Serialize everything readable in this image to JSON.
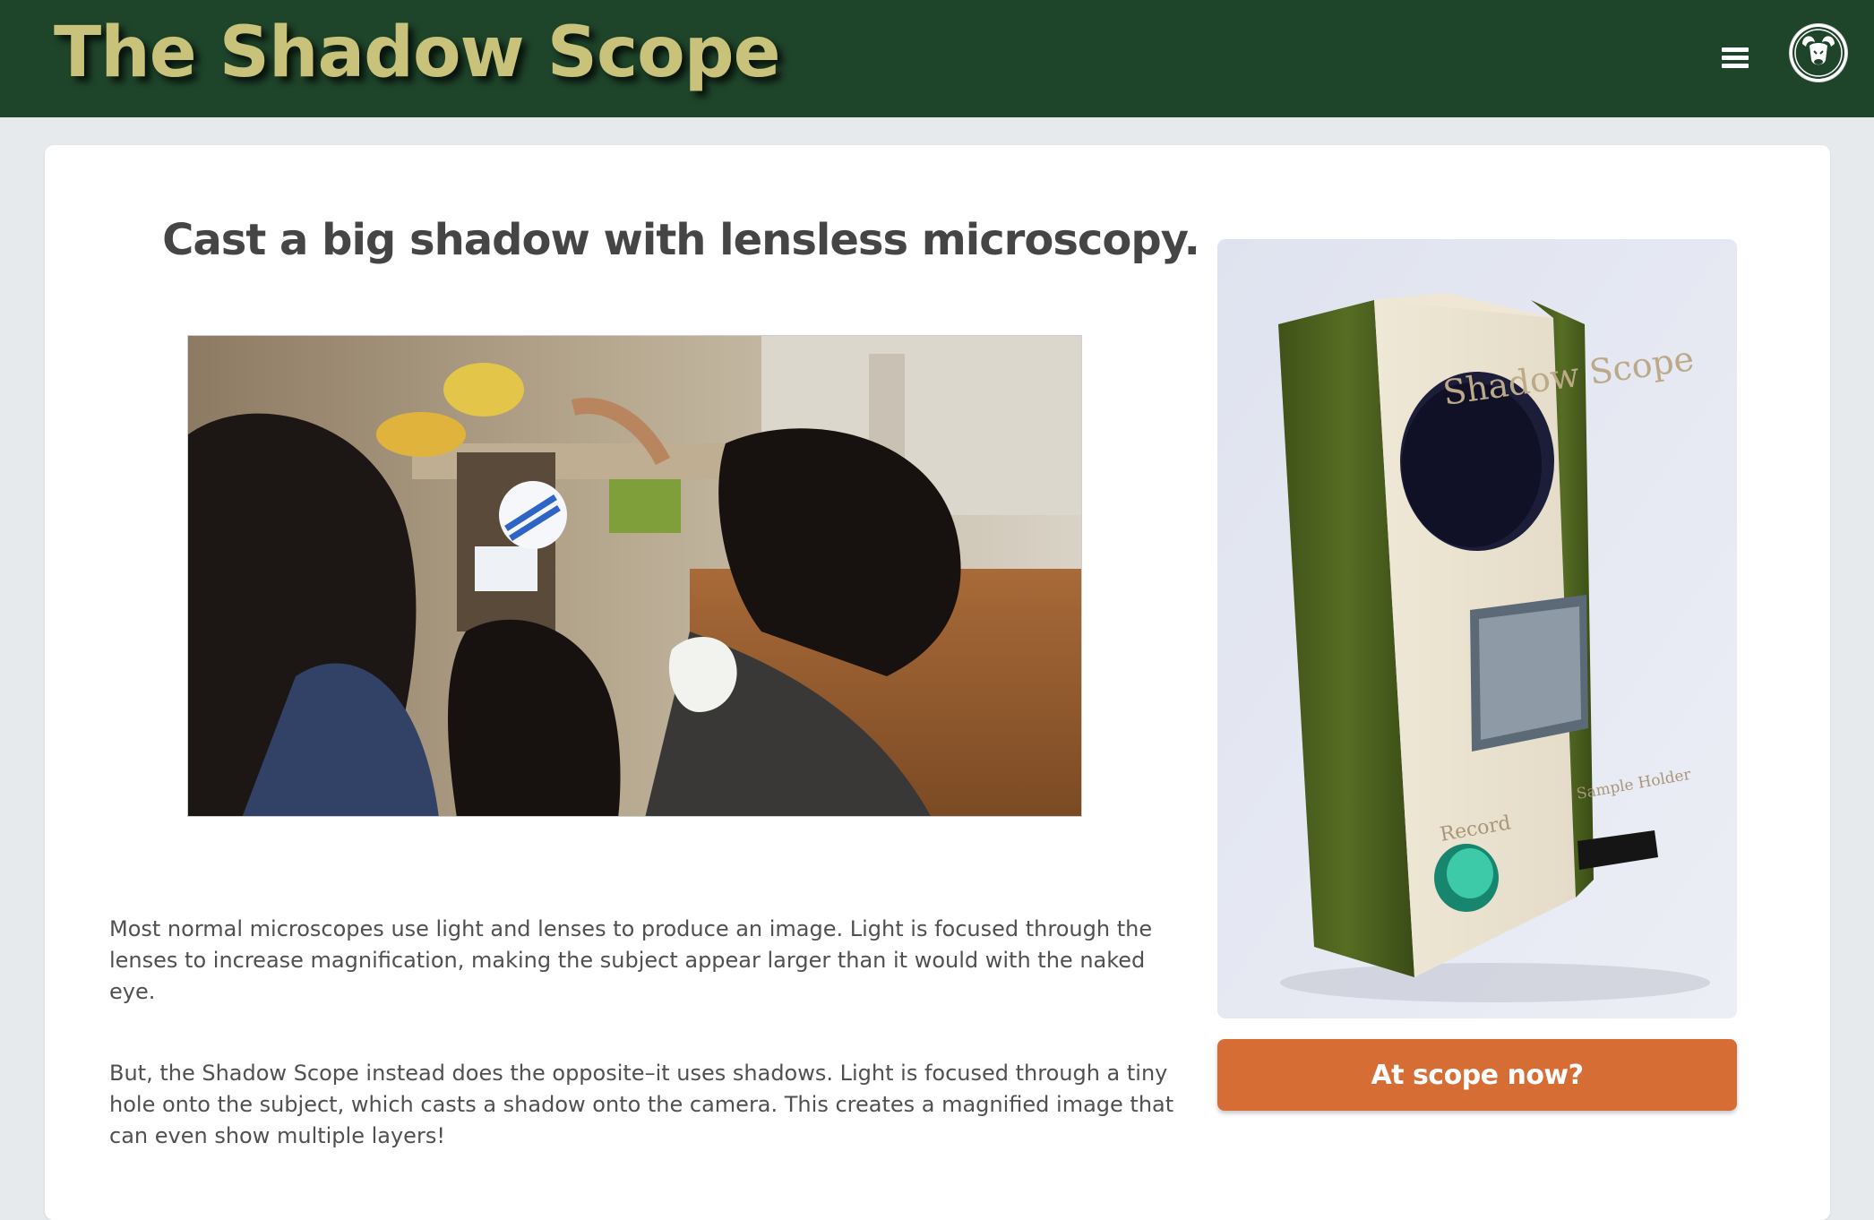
{
  "header": {
    "site_title": "The Shadow Scope",
    "menu_icon": "hamburger-icon",
    "logo_icon": "ram-logo-icon",
    "background_color": "#1e442a",
    "title_color": "#c8c27a"
  },
  "main": {
    "headline": "Cast a big shadow with lensless microscopy.",
    "paragraphs": [
      "Most normal microscopes use light and lenses to produce an image. Light is focused through the lenses to increase magnification, making the subject appear larger than it would with the naked eye.",
      "But, the Shadow Scope instead does the opposite–it uses shadows. Light is focused through a tiny hole onto the subject, which casts a shadow onto the camera. This creates a magnified image that can even show multiple layers!"
    ]
  },
  "sidebar": {
    "scope_engraving": {
      "title": "Shadow Scope",
      "record_label": "Record",
      "sample_holder_label": "Sample Holder"
    },
    "cta_label": "At scope now?",
    "cta_color": "#d66d34"
  }
}
